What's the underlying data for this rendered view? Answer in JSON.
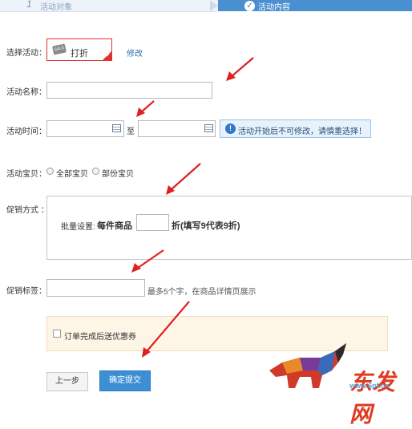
{
  "steps": {
    "step1_number": "1",
    "step1_label": "活动对象",
    "step2_label": "活动内容"
  },
  "activity": {
    "label": "选择活动：",
    "tag_text": "SALE",
    "selected": "打折",
    "edit_link": "修改"
  },
  "name": {
    "label": "活动名称：",
    "value": ""
  },
  "time": {
    "label": "活动时间：",
    "separator": "至",
    "notice": "活动开始后不可修改，请慎重选择！"
  },
  "items": {
    "label": "活动宝贝：",
    "options": [
      "全部宝贝",
      "部份宝贝"
    ]
  },
  "promo": {
    "label": "促销方式 ：",
    "bulk_label": "批量设置:",
    "each_item": "每件商品",
    "discount_value": "",
    "discount_hint": "折(填写9代表9折)"
  },
  "tag": {
    "label": "促销标签：",
    "value": "",
    "hint": "最多5个字，在商品详情页展示"
  },
  "coupon": {
    "checkbox_label": "订单完成后送优惠券",
    "checked": false
  },
  "buttons": {
    "prev": "上一步",
    "submit": "确定提交"
  },
  "watermark": {
    "text": "东发网",
    "url": "www.6pf.cn"
  },
  "colors": {
    "accent": "#3d8fd4",
    "annotation_arrow": "#e02020",
    "activity_border": "#e03030",
    "notice_bg": "#e7f2fc",
    "coupon_bg": "#fdf5e6"
  }
}
